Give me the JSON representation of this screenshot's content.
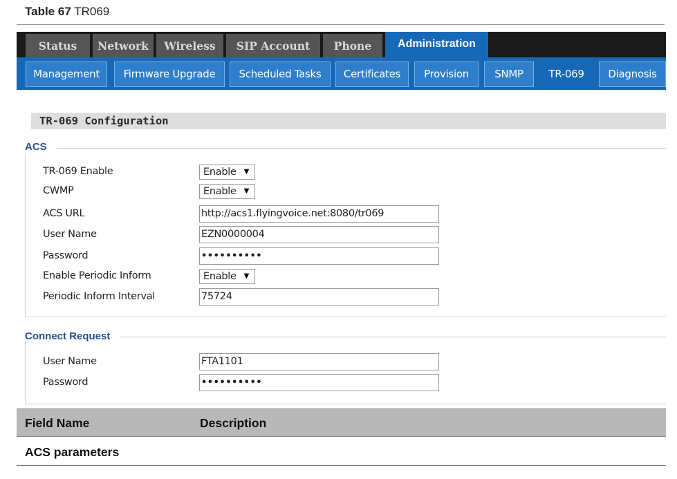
{
  "caption": {
    "label": "Table 67",
    "title": "TR069"
  },
  "top_tabs": [
    "Status",
    "Network",
    "Wireless",
    "SIP Account",
    "Phone",
    "Administration"
  ],
  "sub_tabs": [
    "Management",
    "Firmware Upgrade",
    "Scheduled Tasks",
    "Certificates",
    "Provision",
    "SNMP",
    "TR-069",
    "Diagnosis"
  ],
  "section_title": "TR-069 Configuration",
  "acs": {
    "legend": "ACS",
    "enable_label": "TR-069 Enable",
    "enable_value": "Enable",
    "cwmp_label": "CWMP",
    "cwmp_value": "Enable",
    "url_label": "ACS URL",
    "url_value": "http://acs1.flyingvoice.net:8080/tr069",
    "user_label": "User Name",
    "user_value": "EZN0000004",
    "pass_label": "Password",
    "pass_value": "••••••••••",
    "periodic_label": "Enable Periodic Inform",
    "periodic_value": "Enable",
    "interval_label": "Periodic Inform Interval",
    "interval_value": "75724"
  },
  "connect": {
    "legend": "Connect Request",
    "user_label": "User Name",
    "user_value": "FTA1101",
    "pass_label": "Password",
    "pass_value": "••••••••••"
  },
  "table": {
    "col1": "Field Name",
    "col2": "Description",
    "row1": "ACS parameters"
  },
  "colors": {
    "accent": "#1768b6",
    "tab_inactive": "#555555",
    "legend": "#2a4f8a"
  }
}
